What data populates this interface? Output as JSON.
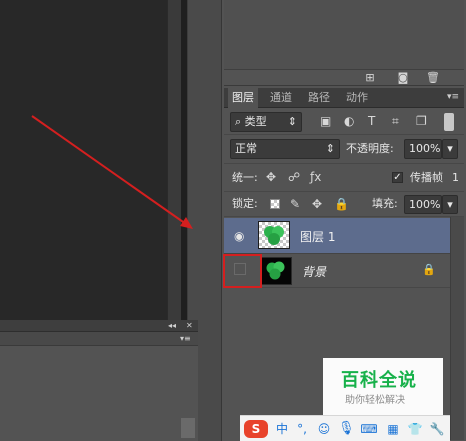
{
  "layers_panel": {
    "tabs": [
      "图层",
      "通道",
      "路径",
      "动作"
    ],
    "filter_kind": "类型",
    "blend_mode": "正常",
    "opacity_label": "不透明度:",
    "opacity_value": "100%",
    "unify_label": "统一:",
    "propagate_label": "传播帧",
    "propagate_value": "1",
    "propagate_checked": true,
    "lock_label": "锁定:",
    "fill_label": "填充:",
    "fill_value": "100%",
    "layers": [
      {
        "name": "图层 1",
        "visible": true,
        "selected": true
      },
      {
        "name": "背景",
        "visible": false,
        "selected": false,
        "locked": true
      }
    ]
  },
  "watermark": {
    "title": "百科全说",
    "subtitle": "助你轻松解决"
  },
  "ime_bar": {
    "items": [
      "S",
      "中",
      "°,",
      "☺",
      "mic",
      "kbd",
      "skin",
      "shirt",
      "wrench"
    ]
  },
  "colors": {
    "selected_layer": "#5d6c8d",
    "annotation_red": "#d41f1f",
    "brand_green": "#17b14a"
  }
}
